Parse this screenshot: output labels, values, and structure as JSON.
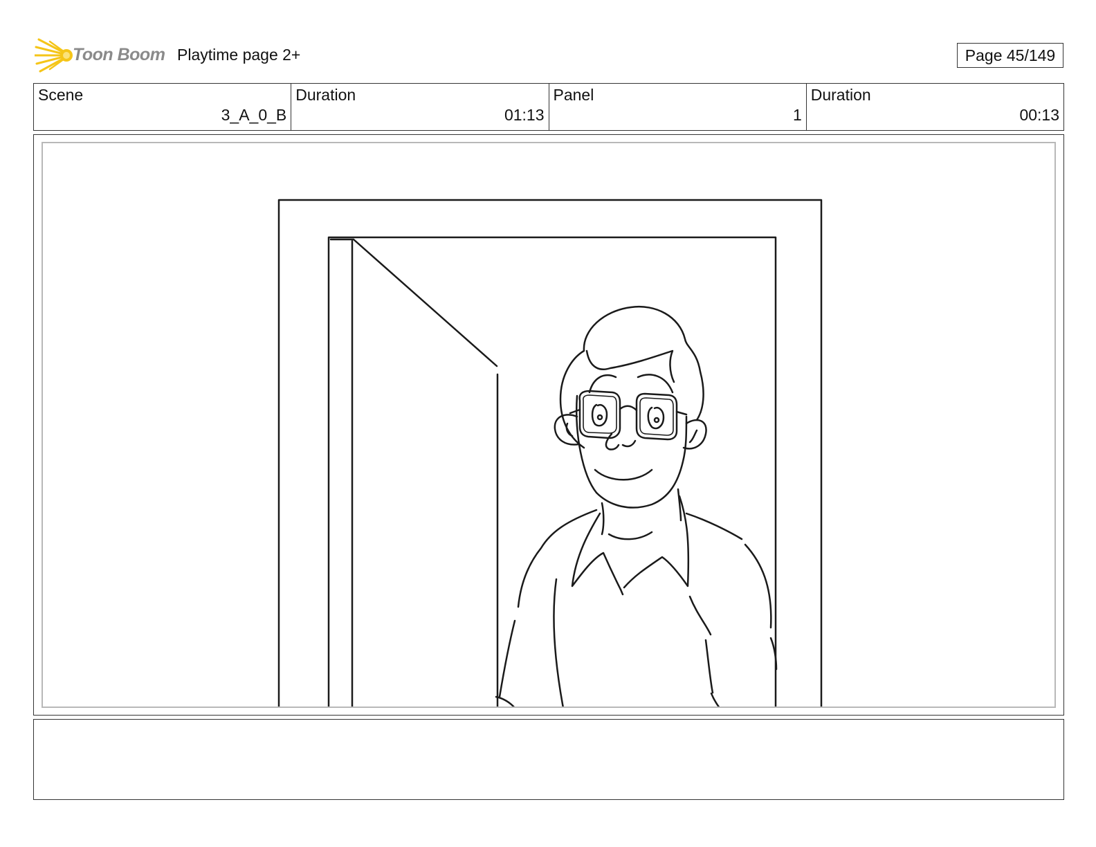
{
  "header": {
    "logo_text": "Toon Boom",
    "title": "Playtime page 2+",
    "page_label": "Page  45/149"
  },
  "info": {
    "scene_label": "Scene",
    "scene_value": "3_A_0_B",
    "scene_duration_label": "Duration",
    "scene_duration_value": "01:13",
    "panel_label": "Panel",
    "panel_value": "1",
    "panel_duration_label": "Duration",
    "panel_duration_value": "00:13"
  },
  "notes": {
    "text": ""
  },
  "colors": {
    "logo_star": "#f5c518",
    "logo_text": "#8a8a8a",
    "border": "#333333",
    "inner_frame": "#b8b8b8"
  }
}
